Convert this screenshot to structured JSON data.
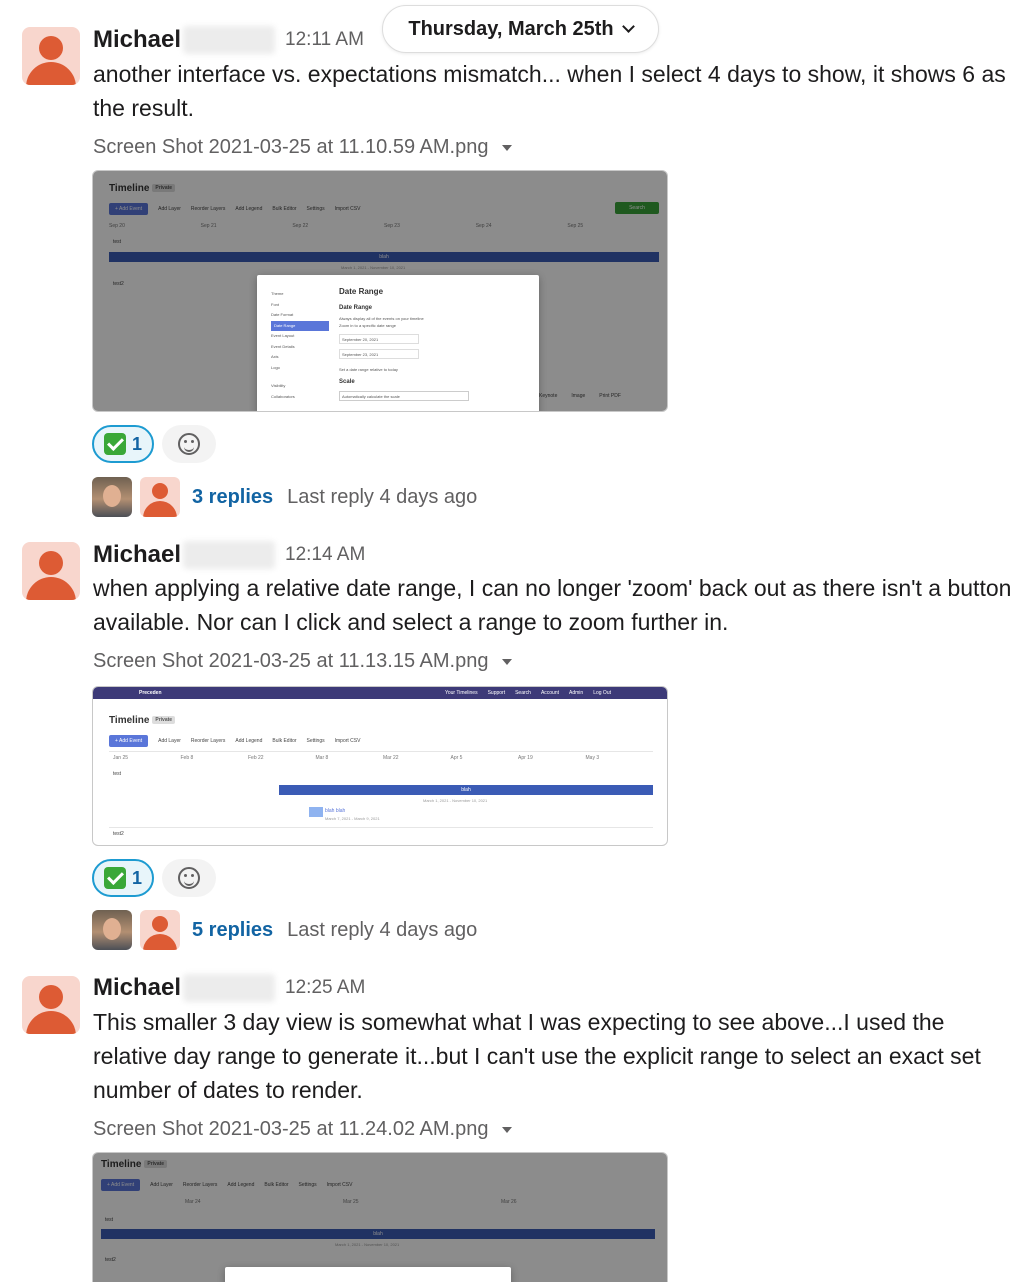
{
  "date_divider": {
    "label": "Thursday, March 25th"
  },
  "messages": [
    {
      "author": "Michael",
      "time": "12:11 AM",
      "text": "another interface vs. expectations mismatch... when I select 4 days to show, it shows 6 as the result.",
      "file": "Screen Shot 2021-03-25 at 11.10.59 AM.png",
      "reaction_count": "1",
      "replies": "3 replies",
      "last_reply": "Last reply 4 days ago"
    },
    {
      "author": "Michael",
      "time": "12:14 AM",
      "text": "when applying a relative date range, I can no longer 'zoom' back out as there isn't a button available. Nor can I click and select a range to zoom further in.",
      "file": "Screen Shot 2021-03-25 at 11.13.15 AM.png",
      "reaction_count": "1",
      "replies": "5 replies",
      "last_reply": "Last reply 4 days ago"
    },
    {
      "author": "Michael",
      "time": "12:25 AM",
      "text": "This smaller 3 day view is somewhat what I was expecting to see above...I used the relative day range to generate it...but I can't use the explicit range to select an exact set number of dates to render.",
      "file": "Screen Shot 2021-03-25 at 11.24.02 AM.png"
    }
  ],
  "shot1": {
    "title": "Timeline",
    "badge": "Private",
    "toolbar": [
      "+ Add Event",
      "Add Layer",
      "Reorder Layers",
      "Add Legend",
      "Bulk Editor",
      "Settings",
      "Import CSV"
    ],
    "search": "Search",
    "cols": [
      "Sep 20",
      "Sep 21",
      "Sep 22",
      "Sep 23",
      "Sep 24",
      "Sep 25"
    ],
    "layer1": "test",
    "layer2": "test2",
    "bar": "blah",
    "bar_dates": "March 1, 2021 - November 10, 2021",
    "modal_menu": [
      "Theme",
      "Font",
      "Date Format",
      "Date Range",
      "Event Layout",
      "Event Details",
      "Axis",
      "Logo",
      "Visibility",
      "Collaborators"
    ],
    "modal_title": "Date Range",
    "modal_sub": "Date Range",
    "opt1": "Always display all of the events on your timeline",
    "opt2": "Zoom in to a specific date range",
    "date1": "September 20, 2021",
    "date2": "September 23, 2021",
    "opt3": "Set a date range relative to today",
    "scale": "Scale",
    "scale_value": "Automatically calculate the scale",
    "footer": [
      "Keynote",
      "Image",
      "Print PDF"
    ]
  },
  "shot2": {
    "brand": "Preceden",
    "nav": [
      "Your Timelines",
      "Support",
      "Search",
      "Account",
      "Admin",
      "Log Out"
    ],
    "title": "Timeline",
    "badge": "Private",
    "toolbar": [
      "+ Add Event",
      "Add Layer",
      "Reorder Layers",
      "Add Legend",
      "Bulk Editor",
      "Settings",
      "Import CSV"
    ],
    "cols": [
      "Jan 25",
      "Feb 8",
      "Feb 22",
      "Mar 8",
      "Mar 22",
      "Apr 5",
      "Apr 19",
      "May 3"
    ],
    "layer1": "test",
    "layer2": "test2",
    "bar": "blah",
    "bar_dates": "March 1, 2021 - November 10, 2021",
    "bar2": "blah blah",
    "bar2_dates": "March 7, 2021 - March 9, 2021"
  },
  "shot3": {
    "title": "Timeline",
    "badge": "Private",
    "toolbar": [
      "+ Add Event",
      "Add Layer",
      "Reorder Layers",
      "Add Legend",
      "Bulk Editor",
      "Settings",
      "Import CSV"
    ],
    "cols": [
      "Mar 24",
      "Mar 25",
      "Mar 26"
    ],
    "layer1": "test",
    "layer2": "test2",
    "bar": "blah",
    "bar_dates": "March 1, 2021 - November 10, 2021"
  }
}
